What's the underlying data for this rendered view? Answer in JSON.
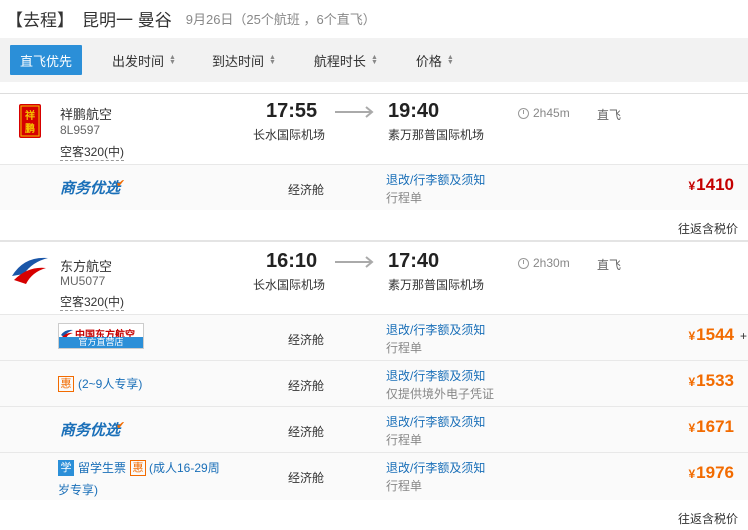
{
  "route": {
    "direction": "【去程】",
    "cities": "昆明一 曼谷",
    "meta": "9月26日（25个航班 ，6个直飞）"
  },
  "sort": {
    "items": [
      "直飞优先",
      "出发时间",
      "到达时间",
      "航程时长",
      "价格"
    ],
    "arrows": "▲▼"
  },
  "flights": [
    {
      "airline": "祥鹏航空",
      "logo_text": "祥鹏",
      "flight_no": "8L9597",
      "aircraft": "空客320(中)",
      "dep_time": "17:55",
      "dep_airport": "长水国际机场",
      "arr_time": "19:40",
      "arr_airport": "素万那普国际机场",
      "duration": "2h45m",
      "type": "直飞",
      "fares": [
        {
          "brand": "商务优选",
          "cabin": "经济舱",
          "rules": "退改/行李额及须知",
          "note": "行程单",
          "currency": "¥",
          "price": "1410"
        }
      ],
      "total_note": "往返含税价"
    },
    {
      "airline": "东方航空",
      "flight_no": "MU5077",
      "aircraft": "空客320(中)",
      "dep_time": "16:10",
      "dep_airport": "长水国际机场",
      "arr_time": "17:40",
      "arr_airport": "素万那普国际机场",
      "duration": "2h30m",
      "type": "直飞",
      "fares": [
        {
          "badge_top": "中国东方航空",
          "badge_bottom": "官方直营店",
          "cabin": "经济舱",
          "rules": "退改/行李额及须知",
          "note": "行程单",
          "currency": "¥",
          "price": "1544",
          "plus": "+"
        },
        {
          "hui": "惠",
          "tag": "(2~9人专享)",
          "cabin": "经济舱",
          "rules": "退改/行李额及须知",
          "note": "仅提供境外电子凭证",
          "currency": "¥",
          "price": "1533"
        },
        {
          "brand": "商务优选",
          "cabin": "经济舱",
          "rules": "退改/行李额及须知",
          "note": "行程单",
          "currency": "¥",
          "price": "1671"
        },
        {
          "xue": "学",
          "student": "留学生票",
          "hui": "惠",
          "tag1": "(成人16-29周",
          "tag2": "岁专享)",
          "cabin": "经济舱",
          "rules": "退改/行李额及须知",
          "note": "行程单",
          "currency": "¥",
          "price": "1976"
        }
      ],
      "total_note": "往返含税价"
    }
  ],
  "colors": {
    "accent": "#2b8fd8",
    "price": "#f26b00",
    "price_red": "#c40000",
    "link": "#1a6fb8"
  }
}
